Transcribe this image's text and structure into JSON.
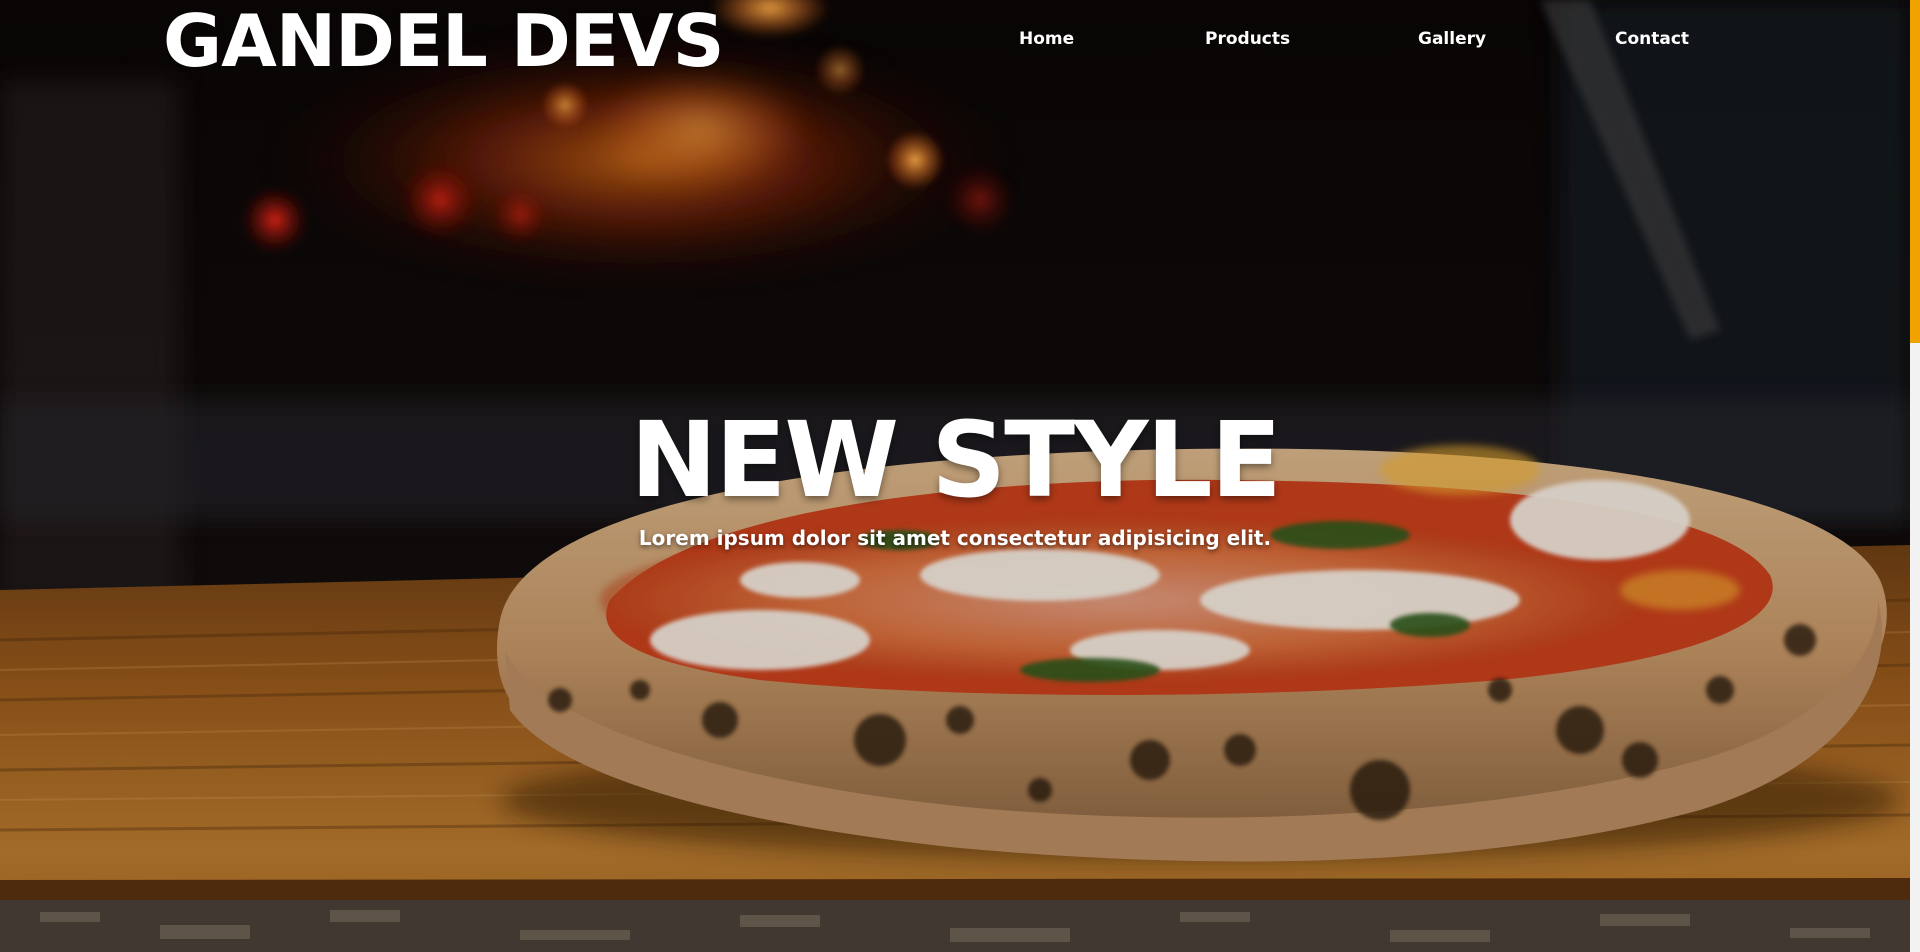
{
  "header": {
    "logo": "GANDEL DEVS",
    "nav": [
      {
        "label": "Home"
      },
      {
        "label": "Products"
      },
      {
        "label": "Gallery"
      },
      {
        "label": "Contact"
      }
    ]
  },
  "hero": {
    "title": "NEW STYLE",
    "subtitle": "Lorem ipsum dolor sit amet consectetur adipisicing elit.",
    "image": "pizza-on-wooden-board-photo"
  },
  "scrollbar": {
    "position_fraction": 0.0,
    "visible_fraction": 0.36
  },
  "colors": {
    "text": "#ffffff",
    "scrollbar_thumb": "#f0a300",
    "scrollbar_track": "#f2f2f2"
  }
}
